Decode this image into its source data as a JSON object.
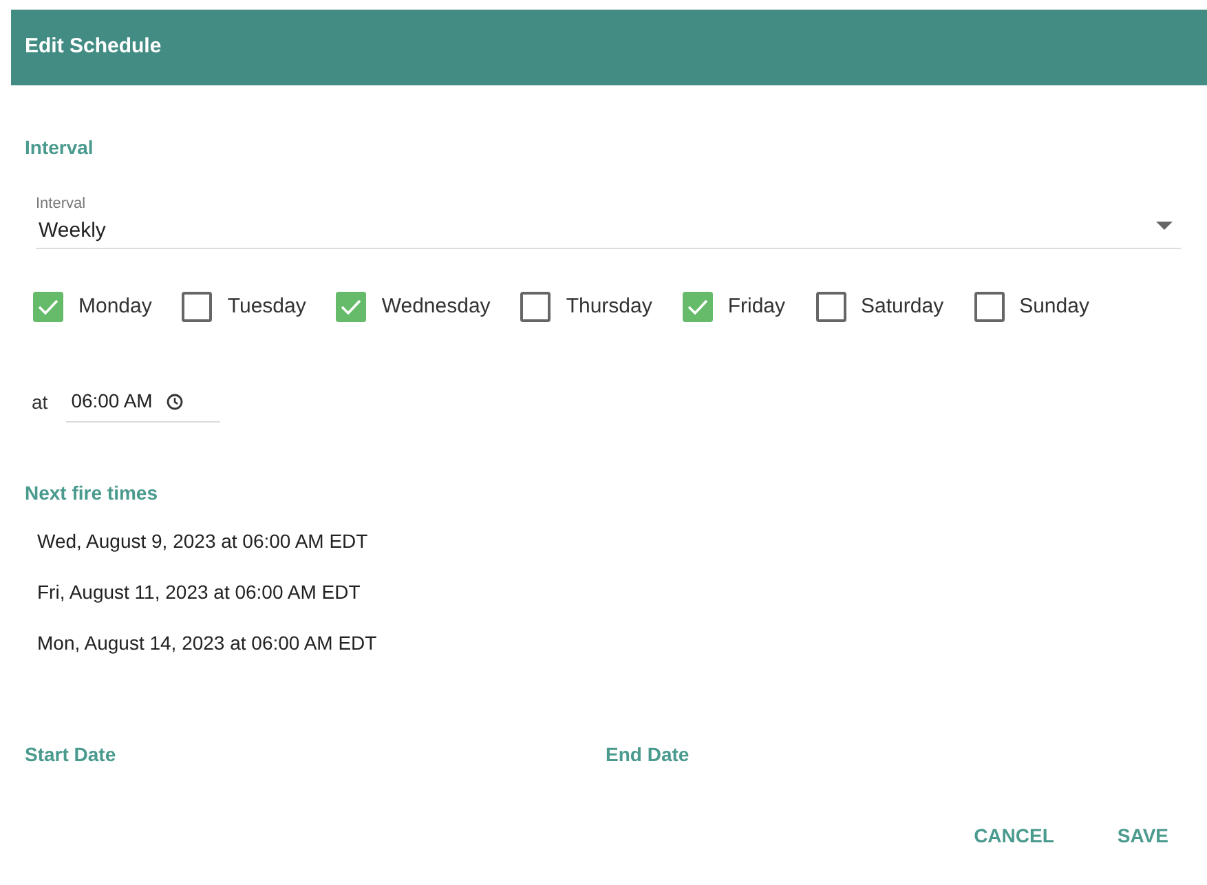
{
  "dialog": {
    "title": "Edit Schedule"
  },
  "interval_section": {
    "heading": "Interval",
    "field": {
      "label": "Interval",
      "value": "Weekly"
    }
  },
  "days": [
    {
      "label": "Monday",
      "checked": true
    },
    {
      "label": "Tuesday",
      "checked": false
    },
    {
      "label": "Wednesday",
      "checked": true
    },
    {
      "label": "Thursday",
      "checked": false
    },
    {
      "label": "Friday",
      "checked": true
    },
    {
      "label": "Saturday",
      "checked": false
    },
    {
      "label": "Sunday",
      "checked": false
    }
  ],
  "time": {
    "prefix": "at",
    "value": "06:00 AM"
  },
  "next_fire_times": {
    "heading": "Next fire times",
    "items": [
      "Wed, August 9, 2023 at 06:00 AM EDT",
      "Fri, August 11, 2023 at 06:00 AM EDT",
      "Mon, August 14, 2023 at 06:00 AM EDT"
    ]
  },
  "start_date": {
    "heading": "Start Date"
  },
  "end_date": {
    "heading": "End Date"
  },
  "buttons": [
    "CANCEL",
    "SAVE"
  ]
}
